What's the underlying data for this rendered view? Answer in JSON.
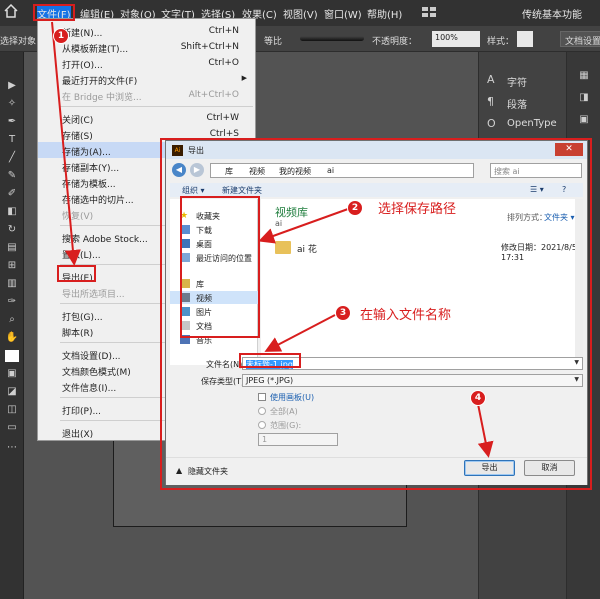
{
  "menubar": {
    "items": [
      {
        "label": "文件(F)"
      },
      {
        "label": "编辑(E)"
      },
      {
        "label": "对象(O)"
      },
      {
        "label": "文字(T)"
      },
      {
        "label": "选择(S)"
      },
      {
        "label": "效果(C)"
      },
      {
        "label": "视图(V)"
      },
      {
        "label": "窗口(W)"
      },
      {
        "label": "帮助(H)"
      }
    ],
    "workspace": "传统基本功能"
  },
  "controlbar": {
    "left_text": "选择对象",
    "proportion": "等比",
    "opacity_label": "不透明度：",
    "opacity_value": "100%",
    "style_label": "样式：",
    "doc_settings": "文档设置"
  },
  "right_panel": {
    "items": [
      {
        "label": "字符",
        "icon": "A"
      },
      {
        "label": "段落",
        "icon": "¶"
      },
      {
        "label": "OpenType",
        "icon": "O"
      }
    ]
  },
  "file_menu": {
    "items": [
      {
        "label": "新建(N)...",
        "shortcut": "Ctrl+N"
      },
      {
        "label": "从模板新建(T)...",
        "shortcut": "Shift+Ctrl+N"
      },
      {
        "label": "打开(O)...",
        "shortcut": "Ctrl+O"
      },
      {
        "label": "最近打开的文件(F)",
        "shortcut": ""
      },
      {
        "label": "在 Bridge 中浏览...",
        "shortcut": "Alt+Ctrl+O"
      },
      {
        "label": "关闭(C)",
        "shortcut": "Ctrl+W"
      },
      {
        "label": "存储(S)",
        "shortcut": "Ctrl+S"
      },
      {
        "label": "存储为(A)...",
        "shortcut": ""
      },
      {
        "label": "存储副本(Y)...",
        "shortcut": ""
      },
      {
        "label": "存储为模板...",
        "shortcut": ""
      },
      {
        "label": "存储选中的切片...",
        "shortcut": ""
      },
      {
        "label": "恢复(V)",
        "shortcut": ""
      },
      {
        "label": "搜索 Adobe Stock...",
        "shortcut": ""
      },
      {
        "label": "置入(L)...",
        "shortcut": ""
      },
      {
        "label": "导出(E)",
        "shortcut": ""
      },
      {
        "label": "导出所选项目...",
        "shortcut": ""
      },
      {
        "label": "打包(G)...",
        "shortcut": ""
      },
      {
        "label": "脚本(R)",
        "shortcut": ""
      },
      {
        "label": "文档设置(D)...",
        "shortcut": ""
      },
      {
        "label": "文档颜色模式(M)",
        "shortcut": ""
      },
      {
        "label": "文件信息(I)...",
        "shortcut": ""
      },
      {
        "label": "打印(P)...",
        "shortcut": ""
      },
      {
        "label": "退出(X)",
        "shortcut": ""
      }
    ]
  },
  "dialog": {
    "title": "导出",
    "path": [
      "库",
      "视频",
      "我的视频",
      "ai"
    ],
    "search_placeholder": "搜索 ai",
    "organize": "组织 ▾",
    "new_folder": "新建文件夹",
    "nav": {
      "favorites": "收藏夹",
      "downloads": "下载",
      "desktop": "桌面",
      "recent": "最近访问的位置",
      "library": "库",
      "videos": "视频",
      "pictures": "图片",
      "documents": "文档",
      "music": "音乐"
    },
    "library_title": "视频库",
    "library_sub": "ai",
    "arrange_label": "排列方式：",
    "arrange_value": "文件夹 ▾",
    "file_item": {
      "name": "ai 花",
      "modified": "修改日期：2021/8/5 17:31"
    },
    "filename_label": "文件名(N):",
    "filename_value": "未标题-1.jpg",
    "filetype_label": "保存类型(T):",
    "filetype_value": "JPEG (*.JPG)",
    "use_artboards": "使用画板(U)",
    "all": "全部(A)",
    "range": "范围(G):",
    "range_value": "1",
    "hide_folders": "隐藏文件夹",
    "export_btn": "导出",
    "cancel_btn": "取消"
  },
  "annotations": {
    "badges": [
      "1",
      "2",
      "3",
      "4"
    ],
    "text2": "选择保存路径",
    "text3": "在输入文件名称"
  }
}
